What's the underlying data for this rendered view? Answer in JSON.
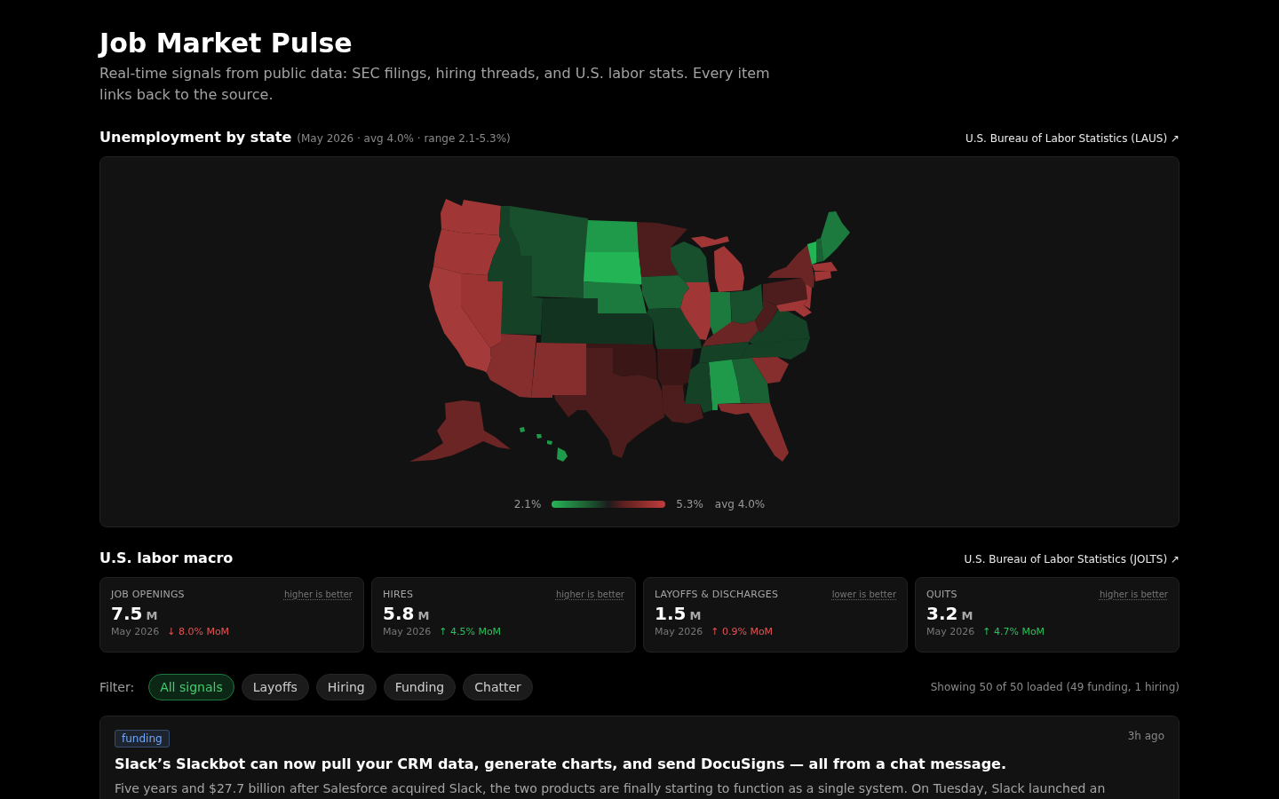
{
  "header": {
    "title": "Job Market Pulse",
    "subtitle": "Real-time signals from public data: SEC filings, hiring threads, and U.S. labor stats. Every item links back to the source."
  },
  "unemployment_map": {
    "title": "Unemployment by state",
    "meta": "(May 2026 · avg 4.0% · range 2.1-5.3%)",
    "source_link": "U.S. Bureau of Labor Statistics (LAUS) ↗",
    "legend": {
      "min": "2.1%",
      "max": "5.3%",
      "average": "avg 4.0%"
    }
  },
  "labor_macro": {
    "title": "U.S. labor macro",
    "source_link": "U.S. Bureau of Labor Statistics (JOLTS) ↗",
    "metrics": [
      {
        "label": "JOB OPENINGS",
        "hint": "higher is better",
        "value": "7.5",
        "unit": "M",
        "period": "May 2026",
        "change": "↓ 8.0% MoM",
        "favorable": false
      },
      {
        "label": "HIRES",
        "hint": "higher is better",
        "value": "5.8",
        "unit": "M",
        "period": "May 2026",
        "change": "↑ 4.5% MoM",
        "favorable": true
      },
      {
        "label": "LAYOFFS & DISCHARGES",
        "hint": "lower is better",
        "value": "1.5",
        "unit": "M",
        "period": "May 2026",
        "change": "↑ 0.9% MoM",
        "favorable": false
      },
      {
        "label": "QUITS",
        "hint": "higher is better",
        "value": "3.2",
        "unit": "M",
        "period": "May 2026",
        "change": "↑ 4.7% MoM",
        "favorable": true
      }
    ]
  },
  "filter": {
    "label": "Filter:",
    "chips": [
      {
        "label": "All signals",
        "selected": true
      },
      {
        "label": "Layoffs",
        "selected": false
      },
      {
        "label": "Hiring",
        "selected": false
      },
      {
        "label": "Funding",
        "selected": false
      },
      {
        "label": "Chatter",
        "selected": false
      }
    ],
    "summary": "Showing 50 of 50 loaded (49 funding, 1 hiring)"
  },
  "feed": [
    {
      "tag": {
        "label": "funding",
        "color": "#6ea8fe"
      },
      "time": "3h ago",
      "headline": "Slack’s Slackbot can now pull your CRM data, generate charts, and send DocuSigns — all from a chat message.",
      "summary": "Five years and $27.7 billion after Salesforce acquired Slack, the two products are finally starting to function as a single system. On Tuesday, Slack launched an"
    }
  ]
}
